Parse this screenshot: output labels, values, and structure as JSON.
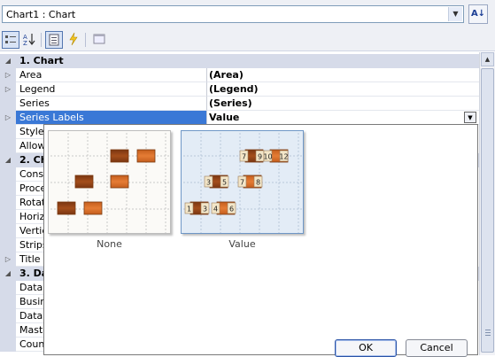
{
  "object_selector": {
    "value": "Chart1 : Chart",
    "sort_icon": "sort-az-icon"
  },
  "toolbar": {
    "buttons": [
      {
        "name": "categorized-icon",
        "pressed": true
      },
      {
        "name": "alphabetical-icon",
        "pressed": false
      },
      {
        "name": "properties-icon",
        "pressed": true
      },
      {
        "name": "events-icon",
        "pressed": false
      },
      {
        "name": "property-pages-icon",
        "pressed": false
      }
    ]
  },
  "categories": [
    {
      "label": "1. Chart"
    },
    {
      "label": "2. Ch"
    },
    {
      "label": "3. Da"
    }
  ],
  "properties": [
    {
      "name": "Area",
      "value": "(Area)"
    },
    {
      "name": "Legend",
      "value": "(Legend)"
    },
    {
      "name": "Series",
      "value": "(Series)"
    },
    {
      "name": "Series Labels",
      "value": "Value"
    },
    {
      "name": "Style",
      "value": ""
    },
    {
      "name": "Allow",
      "value": ""
    },
    {
      "name": "Cons",
      "value": ""
    },
    {
      "name": "Proce",
      "value": ""
    },
    {
      "name": "Rotat",
      "value": ""
    },
    {
      "name": "Horiz",
      "value": ""
    },
    {
      "name": "Vertic",
      "value": ""
    },
    {
      "name": "Strips",
      "value": ""
    },
    {
      "name": "Title",
      "value": ""
    },
    {
      "name": "Data",
      "value": ""
    },
    {
      "name": "Busin",
      "value": ""
    },
    {
      "name": "Data",
      "value": ""
    },
    {
      "name": "Maste",
      "value": ""
    },
    {
      "name": "Coun",
      "value": ""
    }
  ],
  "dropdown": {
    "options": [
      {
        "label": "None",
        "selected": false
      },
      {
        "label": "Value",
        "selected": true
      }
    ],
    "value_labels": [
      "7",
      "9",
      "10",
      "12",
      "3",
      "5",
      "7",
      "8",
      "1",
      "3",
      "4",
      "6"
    ],
    "ok_label": "OK",
    "cancel_label": "Cancel"
  },
  "colors": {
    "bar_dark": "#a44e1b",
    "bar_light": "#e57c35",
    "selection": "#3a78d6",
    "category_bg": "#d6dbe9"
  }
}
